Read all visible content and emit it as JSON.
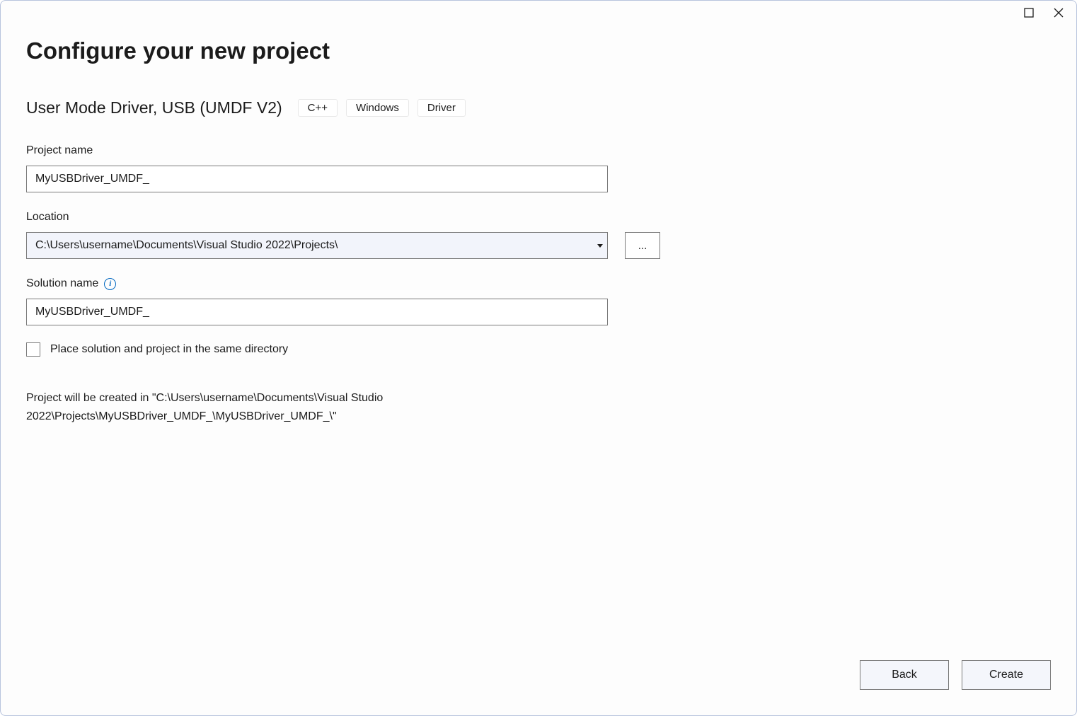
{
  "header": {
    "title": "Configure your new project"
  },
  "template": {
    "name": "User Mode Driver, USB (UMDF V2)",
    "tags": [
      "C++",
      "Windows",
      "Driver"
    ]
  },
  "form": {
    "project_name_label": "Project name",
    "project_name_value": "MyUSBDriver_UMDF_",
    "location_label": "Location",
    "location_value": "C:\\Users\\username\\Documents\\Visual Studio 2022\\Projects\\",
    "browse_label": "...",
    "solution_name_label": "Solution name",
    "solution_name_value": "MyUSBDriver_UMDF_",
    "same_directory_label": "Place solution and project in the same directory",
    "same_directory_checked": false
  },
  "hint": {
    "text": "Project will be created in \"C:\\Users\\username\\Documents\\Visual Studio 2022\\Projects\\MyUSBDriver_UMDF_\\MyUSBDriver_UMDF_\\\""
  },
  "footer": {
    "back_label": "Back",
    "create_label": "Create"
  }
}
